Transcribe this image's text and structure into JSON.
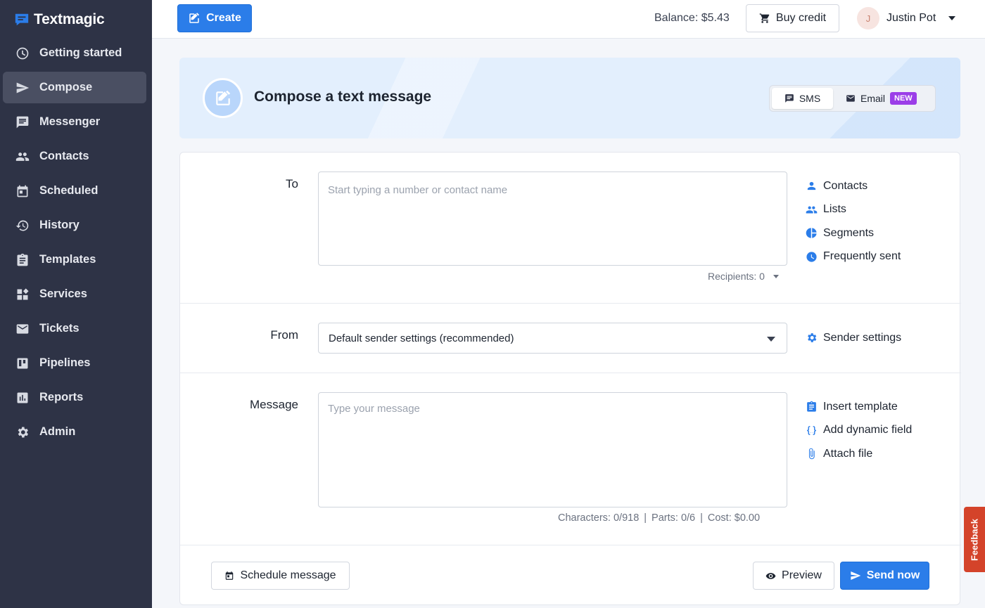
{
  "app": {
    "logo_text": "Textmagic",
    "brand_color": "#2b7de9",
    "sidebar_color": "#2e3346"
  },
  "sidebar": {
    "items": [
      {
        "label": "Getting started",
        "icon": "getting-started-icon"
      },
      {
        "label": "Compose",
        "icon": "send-icon",
        "active": true
      },
      {
        "label": "Messenger",
        "icon": "chat-icon"
      },
      {
        "label": "Contacts",
        "icon": "contacts-icon"
      },
      {
        "label": "Scheduled",
        "icon": "calendar-icon"
      },
      {
        "label": "History",
        "icon": "history-icon"
      },
      {
        "label": "Templates",
        "icon": "clipboard-icon"
      },
      {
        "label": "Services",
        "icon": "services-icon"
      },
      {
        "label": "Tickets",
        "icon": "mail-icon"
      },
      {
        "label": "Pipelines",
        "icon": "board-icon"
      },
      {
        "label": "Reports",
        "icon": "bar-chart-icon"
      },
      {
        "label": "Admin",
        "icon": "gear-icon"
      }
    ]
  },
  "topbar": {
    "create_label": "Create",
    "balance": "Balance: $5.43",
    "buy_credit_label": "Buy credit",
    "user_initial": "J",
    "user_name": "Justin Pot"
  },
  "banner": {
    "title": "Compose a text message",
    "tab_sms": "SMS",
    "tab_email": "Email",
    "new_badge": "NEW"
  },
  "form": {
    "to_label": "To",
    "to_placeholder": "Start typing a number or contact name",
    "recipients": "Recipients: 0",
    "to_links": [
      "Contacts",
      "Lists",
      "Segments",
      "Frequently sent"
    ],
    "from_label": "From",
    "from_value": "Default sender settings (recommended)",
    "sender_settings": "Sender settings",
    "message_label": "Message",
    "message_placeholder": "Type your message",
    "message_links": [
      "Insert template",
      "Add dynamic field",
      "Attach file"
    ],
    "characters": "Characters: 0/918",
    "parts": "Parts: 0/6",
    "cost": "Cost: $0.00",
    "count_separator": "|",
    "schedule_label": "Schedule message",
    "preview_label": "Preview",
    "send_label": "Send now"
  },
  "feedback_label": "Feedback"
}
